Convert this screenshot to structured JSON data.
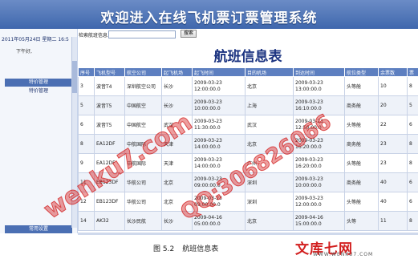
{
  "header": {
    "title": "欢迎进入在线飞机票订票管理系统"
  },
  "sidebar": {
    "date_text": "2011年05月24日 星期二 16:5",
    "greeting": "下午好,",
    "section_header": "特价管理",
    "items": [
      "特价管理"
    ],
    "bottom_header": "常用设置"
  },
  "search": {
    "label": "检索航班信息",
    "value": "",
    "button_label": "搜索"
  },
  "page_title": "航班信息表",
  "table": {
    "columns": [
      "序号",
      "飞机型号",
      "航空公司",
      "起飞机场",
      "起飞时间",
      "目的机场",
      "到达时间",
      "航位类型",
      "余票数",
      "票"
    ],
    "rows": [
      [
        "3",
        "波音T4",
        "深圳航空公司",
        "长沙",
        "2009-03-23 12:00:00.0",
        "北京",
        "2009-03-23 13:00:00.0",
        "头等舱",
        "10",
        "8"
      ],
      [
        "5",
        "波音T5",
        "中国航空",
        "长沙",
        "2009-03-23 10:00:00.0",
        "上海",
        "2009-03-23 16:10:00.0",
        "商务舱",
        "20",
        "5"
      ],
      [
        "6",
        "波音T5",
        "中国航空",
        "武汉",
        "2009-03-23 11:30:00.0",
        "武汉",
        "2009-03-23 12:50:00.0",
        "头等舱",
        "22",
        "6"
      ],
      [
        "8",
        "EA12DF",
        "中航国际",
        "天津",
        "2009-03-23 14:00:00.0",
        "北京",
        "2009-03-23 16:20:00.0",
        "商务舱",
        "23",
        "8"
      ],
      [
        "9",
        "EA12DF",
        "中航国际",
        "天津",
        "2009-03-23 14:00:00.0",
        "广州",
        "2009-03-23 16:20:00.0",
        "头等舱",
        "23",
        "8"
      ],
      [
        "11",
        "EB123DF",
        "华航公司",
        "北京",
        "2009-03-23 09:00:00.0",
        "深圳",
        "2009-03-23 10:00:00.0",
        "商务舱",
        "40",
        "6"
      ],
      [
        "12",
        "EB123DF",
        "华航公司",
        "北京",
        "2009-03-23 09:00:00.0",
        "深圳",
        "2009-03-23 12:00:00.0",
        "头等舱",
        "40",
        "6"
      ],
      [
        "14",
        "AK32",
        "长沙民航",
        "长沙",
        "2009-04-16 05:00:00.0",
        "北京",
        "2009-04-16 15:00:00.0",
        "头等",
        "11",
        "8"
      ]
    ]
  },
  "caption": {
    "number": "图 5.2",
    "text": "航班信息表"
  },
  "watermarks": {
    "logo_text": "文库七网",
    "logo_url": "WWW.WENKU7.COM",
    "diagonal_1": "wenku7.com",
    "diagonal_2": "QQ:306826066"
  },
  "colors": {
    "header_bg": "#4a72b8",
    "title_blue": "#1b3380",
    "table_header_bg": "#5d7fc0",
    "watermark_red": "#d21f1f"
  }
}
